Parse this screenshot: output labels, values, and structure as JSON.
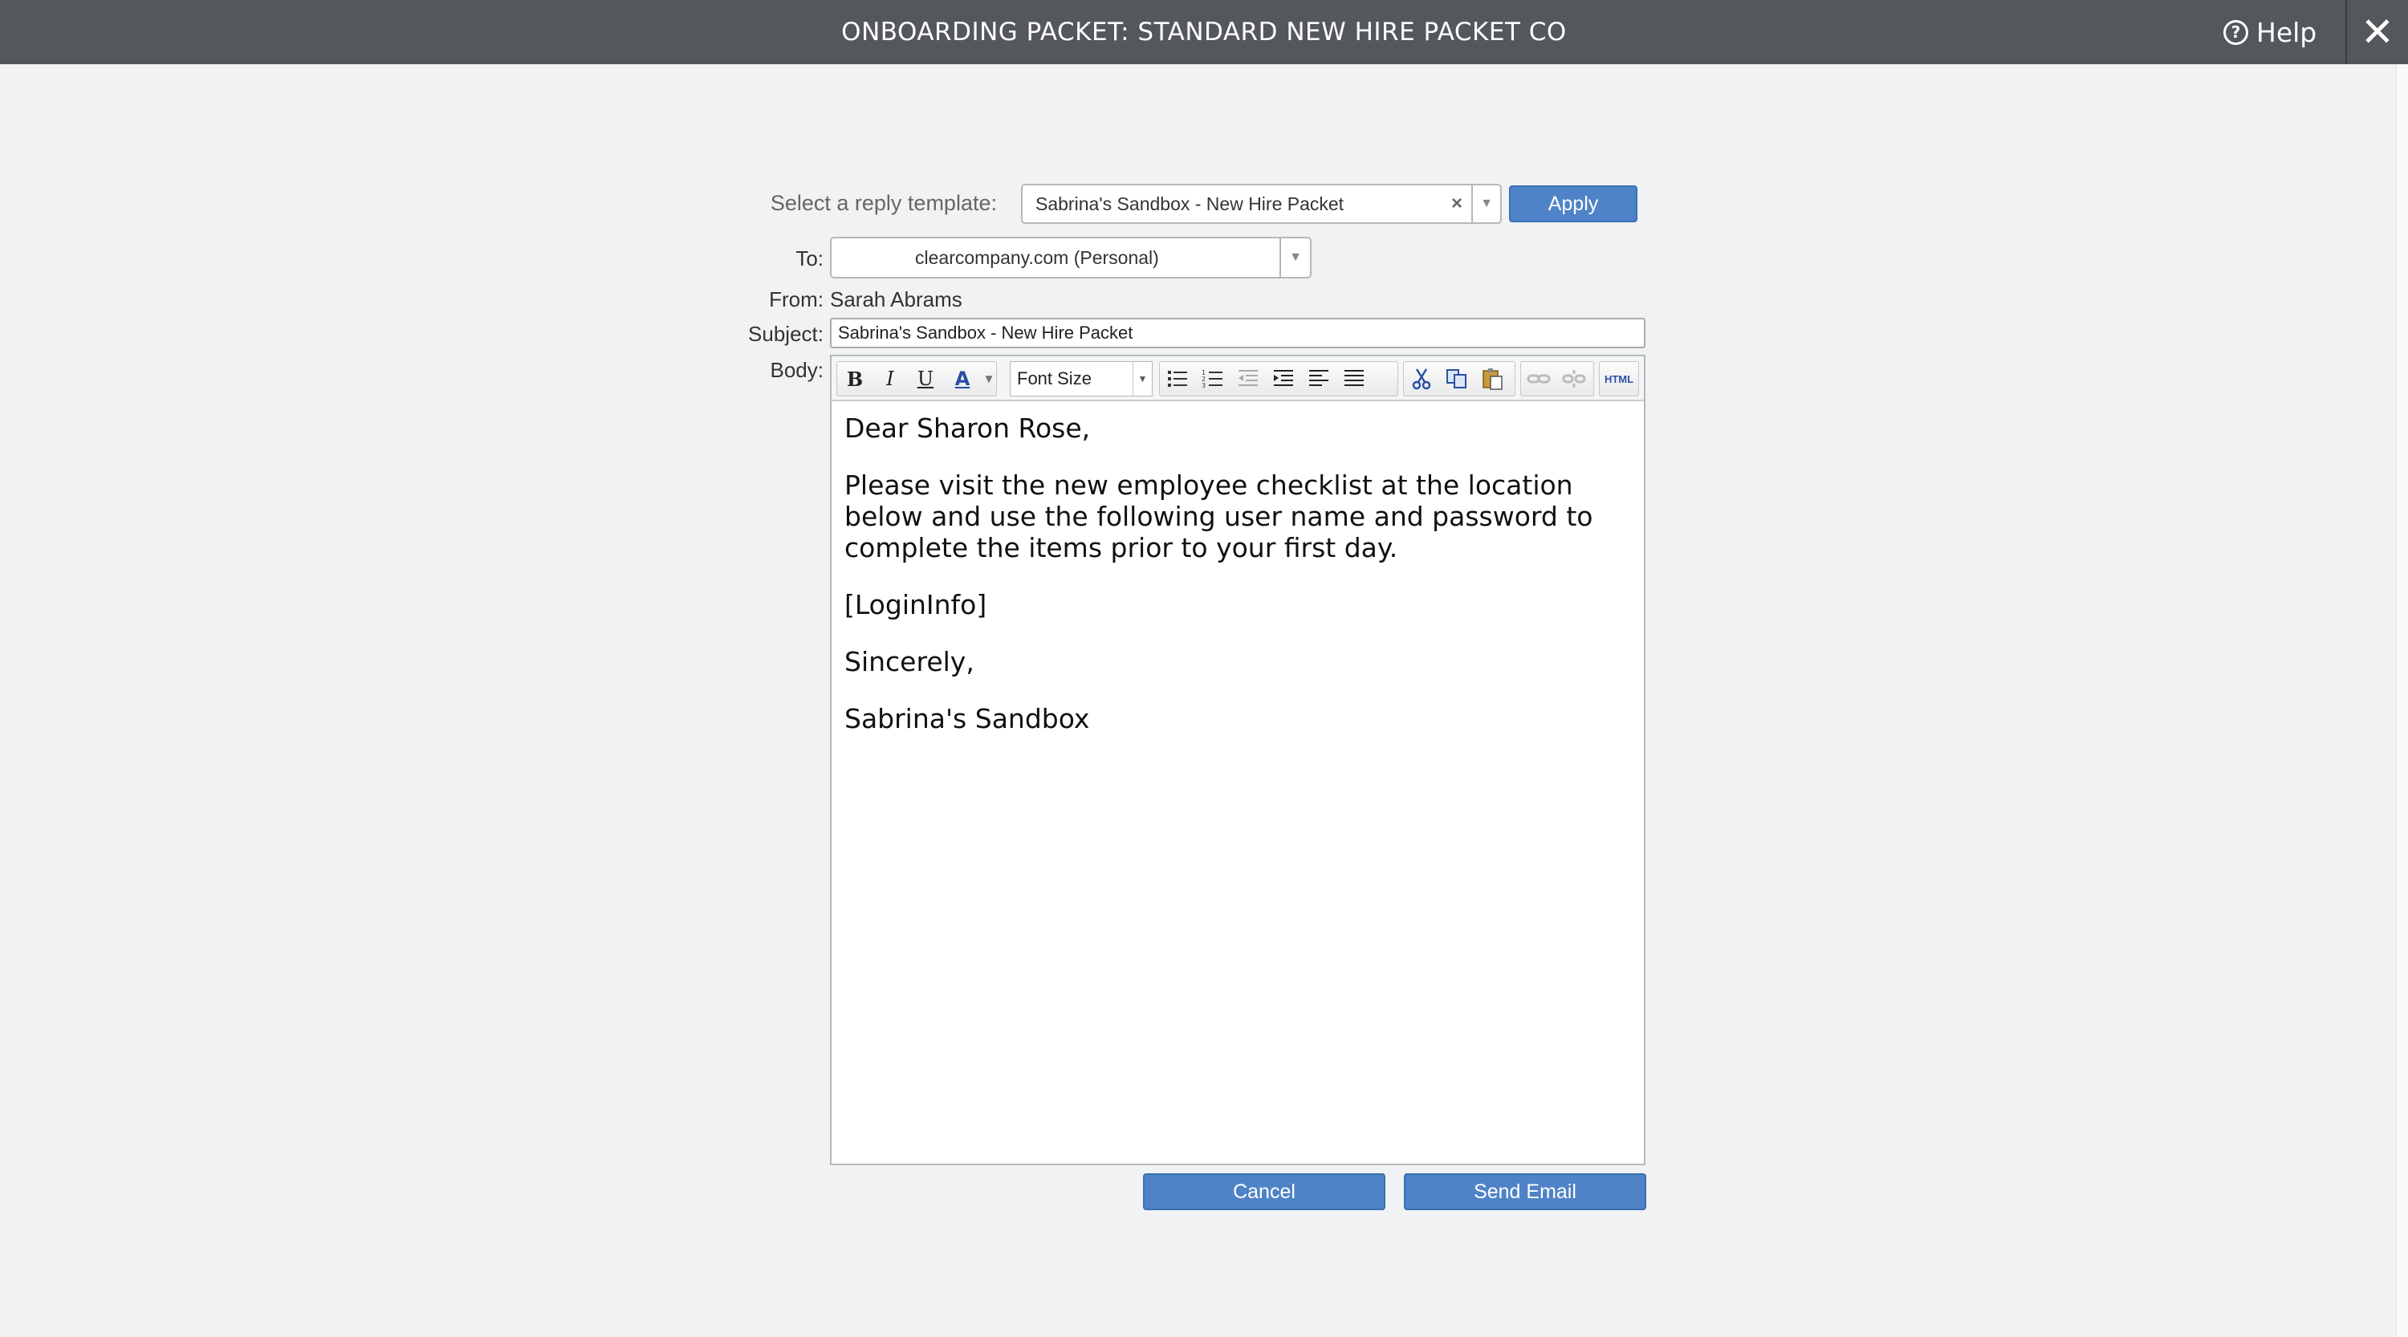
{
  "header": {
    "title": "ONBOARDING PACKET: STANDARD NEW HIRE PACKET CO",
    "help_label": "Help",
    "close_glyph": "✕"
  },
  "form": {
    "template_label": "Select a reply template:",
    "template_value": "Sabrina's Sandbox - New Hire Packet",
    "apply_label": "Apply",
    "to_label": "To:",
    "to_value": "clearcompany.com (Personal)",
    "from_label": "From:",
    "from_value": "Sarah Abrams",
    "subject_label": "Subject:",
    "subject_value": "Sabrina's Sandbox - New Hire Packet",
    "body_label": "Body:"
  },
  "toolbar": {
    "bold": "B",
    "italic": "I",
    "underline": "U",
    "font_color": "A",
    "font_size_label": "Font Size",
    "html_label": "HTML"
  },
  "body": {
    "greeting": "Dear Sharon Rose,",
    "paragraph": "Please visit the new employee checklist at the location below and use the following user name and password to complete the items prior to your first day.",
    "login_placeholder": "[LoginInfo]",
    "closing": "Sincerely,",
    "signature": "Sabrina's Sandbox"
  },
  "actions": {
    "cancel_label": "Cancel",
    "send_label": "Send Email"
  },
  "colors": {
    "header_bg": "#54575b",
    "button_blue": "#4f83c7",
    "page_bg": "#f0f2f4"
  }
}
